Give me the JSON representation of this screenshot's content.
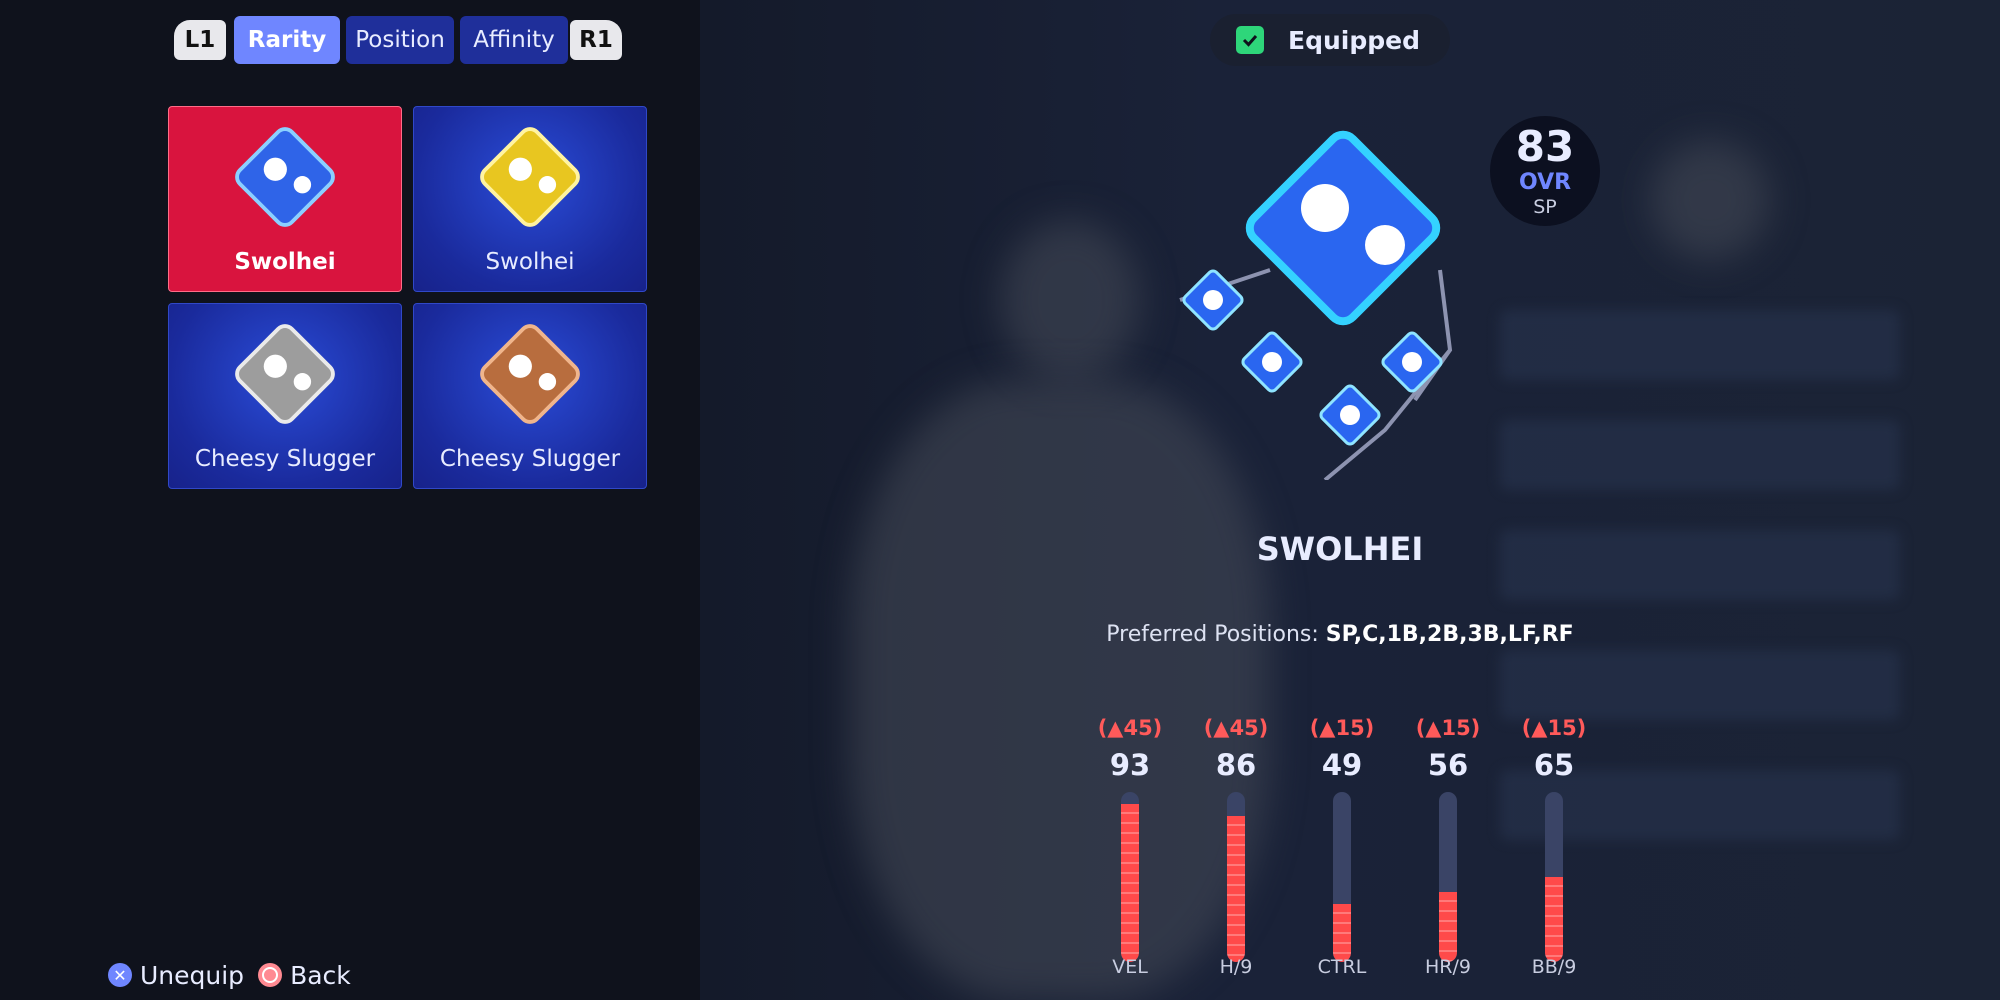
{
  "tabs": {
    "bumper_left": "L1",
    "items": [
      "Rarity",
      "Position",
      "Affinity"
    ],
    "active": "Rarity",
    "bumper_right": "R1"
  },
  "perks": [
    {
      "name": "Swolhei",
      "tier_color": "#3a7bff",
      "selected": true
    },
    {
      "name": "Swolhei",
      "tier_color": "#e8c620",
      "selected": false
    },
    {
      "name": "Cheesy Slugger",
      "tier_color": "#bdbdbd",
      "selected": false
    },
    {
      "name": "Cheesy Slugger",
      "tier_color": "#b86d3e",
      "selected": false
    }
  ],
  "equipped": {
    "label": "Equipped",
    "checked": true
  },
  "ovr": {
    "value": "83",
    "label": "OVR",
    "position": "SP"
  },
  "perk_title": "SWOLHEI",
  "preferred": {
    "label": "Preferred Positions:",
    "values": "SP,C,1B,2B,3B,LF,RF"
  },
  "stats": [
    {
      "label": "VEL",
      "value": "93",
      "delta": "(▲45)",
      "fill": 0.93
    },
    {
      "label": "H/9",
      "value": "86",
      "delta": "(▲45)",
      "fill": 0.86
    },
    {
      "label": "CTRL",
      "value": "49",
      "delta": "(▲15)",
      "fill": 0.34
    },
    {
      "label": "HR/9",
      "value": "56",
      "delta": "(▲15)",
      "fill": 0.41
    },
    {
      "label": "BB/9",
      "value": "65",
      "delta": "(▲15)",
      "fill": 0.5
    }
  ],
  "footer": {
    "unequip": "Unequip",
    "back": "Back"
  },
  "colors": {
    "accent": "#6f86ff",
    "selected_card": "#d9143e",
    "stat_fill": "#ff4a4a",
    "equipped_check": "#2ed67a"
  }
}
